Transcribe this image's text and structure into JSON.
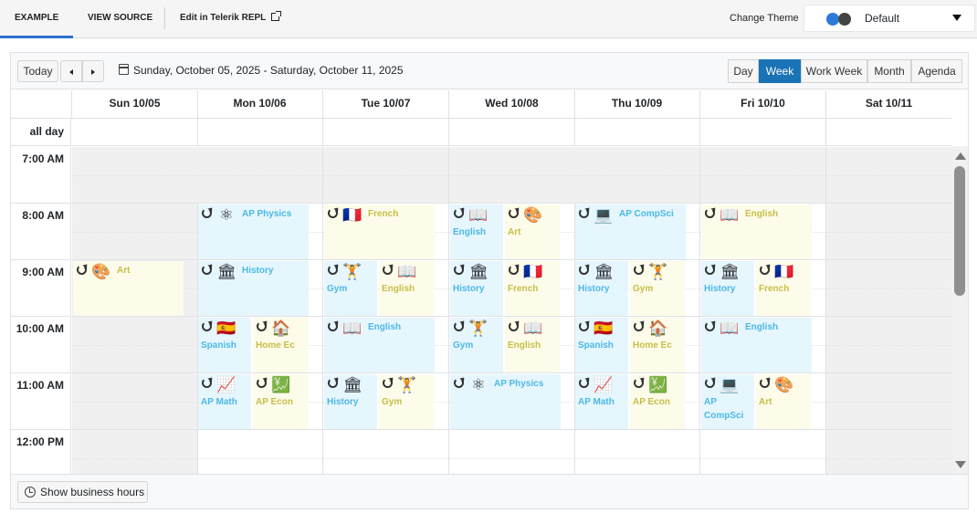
{
  "tabs": {
    "example": "EXAMPLE",
    "view_source": "VIEW SOURCE",
    "repl": "Edit in Telerik REPL"
  },
  "theme": {
    "label": "Change Theme",
    "value": "Default"
  },
  "toolbar": {
    "today": "Today",
    "range": "Sunday, October 05, 2025 - Saturday, October 11, 2025",
    "views": [
      "Day",
      "Week",
      "Work Week",
      "Month",
      "Agenda"
    ],
    "selected_view": "Week"
  },
  "days": [
    "Sun 10/05",
    "Mon 10/06",
    "Tue 10/07",
    "Wed 10/08",
    "Thu 10/09",
    "Fri 10/10",
    "Sat 10/11"
  ],
  "allday_label": "all day",
  "times": [
    "7:00 AM",
    "8:00 AM",
    "9:00 AM",
    "10:00 AM",
    "11:00 AM",
    "12:00 PM"
  ],
  "footer": {
    "business_hours": "Show business hours"
  },
  "events": [
    {
      "day": 1,
      "hour": 1,
      "pos": "full",
      "color": "blue",
      "title": "AP Physics",
      "icon": "atom-icon",
      "glyph": "⚛",
      "layout": "right"
    },
    {
      "day": 2,
      "hour": 1,
      "pos": "full",
      "color": "yellow",
      "title": "French",
      "icon": "france-flag-icon",
      "glyph": "🇫🇷",
      "layout": "right"
    },
    {
      "day": 3,
      "hour": 1,
      "pos": "left",
      "color": "blue",
      "title": "English",
      "icon": "book-icon",
      "glyph": "📖",
      "layout": "below"
    },
    {
      "day": 3,
      "hour": 1,
      "pos": "right",
      "color": "yellow",
      "title": "Art",
      "icon": "palette-icon",
      "glyph": "🎨",
      "layout": "below"
    },
    {
      "day": 4,
      "hour": 1,
      "pos": "full",
      "color": "blue",
      "title": "AP CompSci",
      "icon": "code-icon",
      "glyph": "💻",
      "layout": "right"
    },
    {
      "day": 5,
      "hour": 1,
      "pos": "full",
      "color": "yellow",
      "title": "English",
      "icon": "book-icon",
      "glyph": "📖",
      "layout": "right"
    },
    {
      "day": 0,
      "hour": 2,
      "pos": "full",
      "color": "yellow",
      "title": "Art",
      "icon": "palette-icon",
      "glyph": "🎨",
      "layout": "right"
    },
    {
      "day": 1,
      "hour": 2,
      "pos": "full",
      "color": "blue",
      "title": "History",
      "icon": "museum-icon",
      "glyph": "🏛",
      "layout": "right"
    },
    {
      "day": 2,
      "hour": 2,
      "pos": "left",
      "color": "blue",
      "title": "Gym",
      "icon": "dumbbell-icon",
      "glyph": "🏋",
      "layout": "below"
    },
    {
      "day": 2,
      "hour": 2,
      "pos": "right",
      "color": "yellow",
      "title": "English",
      "icon": "book-icon",
      "glyph": "📖",
      "layout": "below"
    },
    {
      "day": 3,
      "hour": 2,
      "pos": "left",
      "color": "blue",
      "title": "History",
      "icon": "museum-icon",
      "glyph": "🏛",
      "layout": "below"
    },
    {
      "day": 3,
      "hour": 2,
      "pos": "right",
      "color": "yellow",
      "title": "French",
      "icon": "france-flag-icon",
      "glyph": "🇫🇷",
      "layout": "below"
    },
    {
      "day": 4,
      "hour": 2,
      "pos": "left",
      "color": "blue",
      "title": "History",
      "icon": "museum-icon",
      "glyph": "🏛",
      "layout": "below"
    },
    {
      "day": 4,
      "hour": 2,
      "pos": "right",
      "color": "yellow",
      "title": "Gym",
      "icon": "dumbbell-icon",
      "glyph": "🏋",
      "layout": "below"
    },
    {
      "day": 5,
      "hour": 2,
      "pos": "left",
      "color": "blue",
      "title": "History",
      "icon": "museum-icon",
      "glyph": "🏛",
      "layout": "below"
    },
    {
      "day": 5,
      "hour": 2,
      "pos": "right",
      "color": "yellow",
      "title": "French",
      "icon": "france-flag-icon",
      "glyph": "🇫🇷",
      "layout": "below"
    },
    {
      "day": 1,
      "hour": 3,
      "pos": "left",
      "color": "blue",
      "title": "Spanish",
      "icon": "spain-flag-icon",
      "glyph": "🇪🇸",
      "layout": "below"
    },
    {
      "day": 1,
      "hour": 3,
      "pos": "right",
      "color": "yellow",
      "title": "Home Ec",
      "icon": "house-icon",
      "glyph": "🏠",
      "layout": "below"
    },
    {
      "day": 2,
      "hour": 3,
      "pos": "full",
      "color": "blue",
      "title": "English",
      "icon": "book-icon",
      "glyph": "📖",
      "layout": "right"
    },
    {
      "day": 3,
      "hour": 3,
      "pos": "left",
      "color": "blue",
      "title": "Gym",
      "icon": "dumbbell-icon",
      "glyph": "🏋",
      "layout": "below"
    },
    {
      "day": 3,
      "hour": 3,
      "pos": "right",
      "color": "yellow",
      "title": "English",
      "icon": "book-icon",
      "glyph": "📖",
      "layout": "below"
    },
    {
      "day": 4,
      "hour": 3,
      "pos": "left",
      "color": "blue",
      "title": "Spanish",
      "icon": "spain-flag-icon",
      "glyph": "🇪🇸",
      "layout": "below"
    },
    {
      "day": 4,
      "hour": 3,
      "pos": "right",
      "color": "yellow",
      "title": "Home Ec",
      "icon": "house-icon",
      "glyph": "🏠",
      "layout": "below"
    },
    {
      "day": 5,
      "hour": 3,
      "pos": "full",
      "color": "blue",
      "title": "English",
      "icon": "book-icon",
      "glyph": "📖",
      "layout": "right"
    },
    {
      "day": 1,
      "hour": 4,
      "pos": "left",
      "color": "blue",
      "title": "AP Math",
      "icon": "chart-icon",
      "glyph": "📈",
      "layout": "below"
    },
    {
      "day": 1,
      "hour": 4,
      "pos": "right",
      "color": "yellow",
      "title": "AP Econ",
      "icon": "economy-icon",
      "glyph": "💹",
      "layout": "below"
    },
    {
      "day": 2,
      "hour": 4,
      "pos": "left",
      "color": "blue",
      "title": "History",
      "icon": "museum-icon",
      "glyph": "🏛",
      "layout": "below"
    },
    {
      "day": 2,
      "hour": 4,
      "pos": "right",
      "color": "yellow",
      "title": "Gym",
      "icon": "dumbbell-icon",
      "glyph": "🏋",
      "layout": "below"
    },
    {
      "day": 3,
      "hour": 4,
      "pos": "full",
      "color": "blue",
      "title": "AP Physics",
      "icon": "atom-icon",
      "glyph": "⚛",
      "layout": "right"
    },
    {
      "day": 4,
      "hour": 4,
      "pos": "left",
      "color": "blue",
      "title": "AP Math",
      "icon": "chart-icon",
      "glyph": "📈",
      "layout": "below"
    },
    {
      "day": 4,
      "hour": 4,
      "pos": "right",
      "color": "yellow",
      "title": "AP Econ",
      "icon": "economy-icon",
      "glyph": "💹",
      "layout": "below"
    },
    {
      "day": 5,
      "hour": 4,
      "pos": "left",
      "color": "blue",
      "title": "AP CompSci",
      "icon": "code-icon",
      "glyph": "💻",
      "layout": "below"
    },
    {
      "day": 5,
      "hour": 4,
      "pos": "right",
      "color": "yellow",
      "title": "Art",
      "icon": "palette-icon",
      "glyph": "🎨",
      "layout": "below"
    }
  ]
}
